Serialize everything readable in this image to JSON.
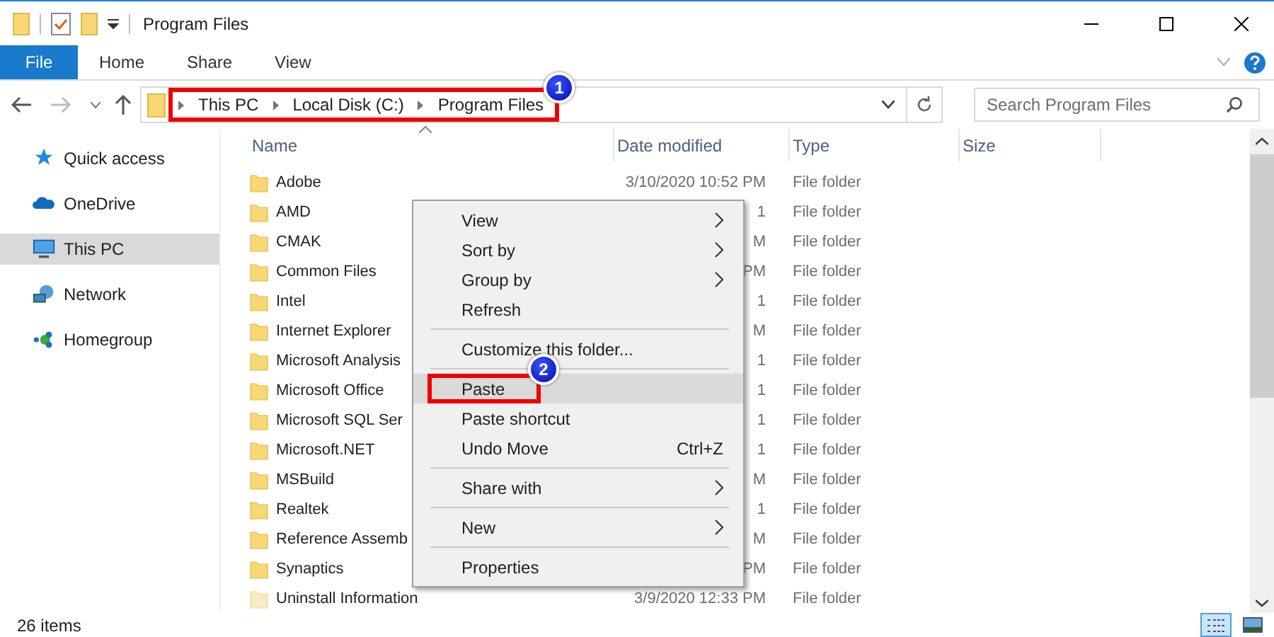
{
  "window": {
    "title": "Program Files"
  },
  "ribbon": {
    "file_tab": "File",
    "tabs": [
      {
        "label": "Home",
        "selected": false
      },
      {
        "label": "Share",
        "selected": false
      },
      {
        "label": "View",
        "selected": false
      }
    ]
  },
  "address": {
    "crumbs": [
      "This PC",
      "Local Disk (C:)",
      "Program Files"
    ],
    "annotation": "1"
  },
  "search": {
    "placeholder": "Search Program Files"
  },
  "sidebar": {
    "items": [
      {
        "label": "Quick access",
        "kind": "star",
        "selected": false
      },
      {
        "label": "OneDrive",
        "kind": "cloud",
        "selected": false
      },
      {
        "label": "This PC",
        "kind": "computer",
        "selected": true
      },
      {
        "label": "Network",
        "kind": "network",
        "selected": false
      },
      {
        "label": "Homegroup",
        "kind": "homegroup",
        "selected": false
      }
    ]
  },
  "columns": [
    "Name",
    "Date modified",
    "Type",
    "Size"
  ],
  "rows": [
    {
      "name": "Adobe",
      "date": "3/10/2020 10:52 PM",
      "type": "File folder",
      "faded": false
    },
    {
      "name": "AMD",
      "date": "1",
      "type": "File folder",
      "faded": false
    },
    {
      "name": "CMAK",
      "date": "M",
      "type": "File folder",
      "faded": false
    },
    {
      "name": "Common Files",
      "date": "PM",
      "type": "File folder",
      "faded": false
    },
    {
      "name": "Intel",
      "date": "1",
      "type": "File folder",
      "faded": false
    },
    {
      "name": "Internet Explorer",
      "date": "M",
      "type": "File folder",
      "faded": false
    },
    {
      "name": "Microsoft Analysis",
      "date": "1",
      "type": "File folder",
      "faded": false
    },
    {
      "name": "Microsoft Office",
      "date": "1",
      "type": "File folder",
      "faded": false
    },
    {
      "name": "Microsoft SQL Ser",
      "date": "1",
      "type": "File folder",
      "faded": false
    },
    {
      "name": "Microsoft.NET",
      "date": "1",
      "type": "File folder",
      "faded": false
    },
    {
      "name": "MSBuild",
      "date": "M",
      "type": "File folder",
      "faded": false
    },
    {
      "name": "Realtek",
      "date": "1",
      "type": "File folder",
      "faded": false
    },
    {
      "name": "Reference Assemb",
      "date": "M",
      "type": "File folder",
      "faded": false
    },
    {
      "name": "Synaptics",
      "date": "PM",
      "type": "File folder",
      "faded": false
    },
    {
      "name": "Uninstall Information",
      "date": "3/9/2020 12:33 PM",
      "type": "File folder",
      "faded": true
    }
  ],
  "context_menu": {
    "annotation": "2",
    "items": [
      {
        "kind": "item",
        "label": "View",
        "submenu": true,
        "selected": false
      },
      {
        "kind": "item",
        "label": "Sort by",
        "submenu": true,
        "selected": false
      },
      {
        "kind": "item",
        "label": "Group by",
        "submenu": true,
        "selected": false
      },
      {
        "kind": "item",
        "label": "Refresh",
        "submenu": false,
        "selected": false
      },
      {
        "kind": "separator"
      },
      {
        "kind": "item",
        "label": "Customize this folder...",
        "submenu": false,
        "selected": false
      },
      {
        "kind": "separator"
      },
      {
        "kind": "item",
        "label": "Paste",
        "submenu": false,
        "selected": true,
        "annotated": true
      },
      {
        "kind": "item",
        "label": "Paste shortcut",
        "submenu": false,
        "selected": false
      },
      {
        "kind": "item",
        "label": "Undo Move",
        "shortcut": "Ctrl+Z",
        "submenu": false,
        "selected": false
      },
      {
        "kind": "separator"
      },
      {
        "kind": "item",
        "label": "Share with",
        "submenu": true,
        "selected": false
      },
      {
        "kind": "separator"
      },
      {
        "kind": "item",
        "label": "New",
        "submenu": true,
        "selected": false
      },
      {
        "kind": "separator"
      },
      {
        "kind": "item",
        "label": "Properties",
        "submenu": false,
        "selected": false
      }
    ]
  },
  "status_bar": {
    "count": "26 items",
    "views": [
      {
        "kind": "details",
        "selected": true
      },
      {
        "kind": "thumbnails",
        "selected": false
      }
    ]
  }
}
